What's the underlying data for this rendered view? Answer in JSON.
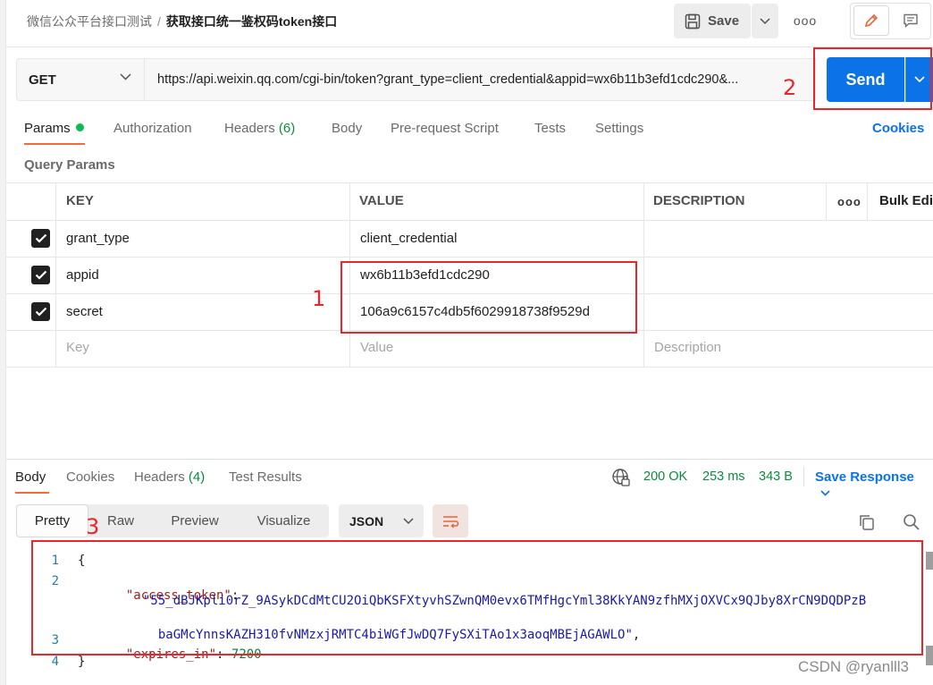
{
  "header": {
    "breadcrumb_parent": "微信公众平台接口测试",
    "breadcrumb_sep": "/",
    "breadcrumb_current": "获取接口统一鉴权码token接口",
    "save_label": "Save",
    "more_label": "ooo"
  },
  "request": {
    "method": "GET",
    "url": "https://api.weixin.qq.com/cgi-bin/token?grant_type=client_credential&appid=wx6b11b3efd1cdc290&...",
    "send_label": "Send"
  },
  "tabs": {
    "params": "Params",
    "authorization": "Authorization",
    "headers": "Headers",
    "headers_count": "(6)",
    "body": "Body",
    "prerequest": "Pre-request Script",
    "tests": "Tests",
    "settings": "Settings",
    "cookies": "Cookies"
  },
  "query_params": {
    "label": "Query Params",
    "columns": {
      "key": "KEY",
      "value": "VALUE",
      "description": "DESCRIPTION",
      "bulk_edit": "Bulk Edit",
      "more": "ooo"
    },
    "rows": [
      {
        "key": "grant_type",
        "value": "client_credential"
      },
      {
        "key": "appid",
        "value": "wx6b11b3efd1cdc290"
      },
      {
        "key": "secret",
        "value": "106a9c6157c4db5f6029918738f9529d"
      }
    ],
    "placeholders": {
      "key": "Key",
      "value": "Value",
      "description": "Description"
    }
  },
  "annotations": {
    "box1": "1",
    "box2": "2",
    "box3": "3",
    "color": "#e8262b"
  },
  "response": {
    "tabs": {
      "body": "Body",
      "cookies": "Cookies",
      "headers": "Headers",
      "headers_count": "(4)",
      "test_results": "Test Results"
    },
    "status": "200 OK",
    "time": "253 ms",
    "size": "343 B",
    "save_response": "Save Response",
    "format_tabs": {
      "pretty": "Pretty",
      "raw": "Raw",
      "preview": "Preview",
      "visualize": "Visualize"
    },
    "format": "JSON",
    "line_numbers": [
      "1",
      "2",
      "3",
      "4"
    ],
    "code": {
      "open": "{",
      "key_access_token": "\"access_token\"",
      "colon": ":",
      "token_line1": "\"55_dBJKpli0rZ_9ASykDCdMtCU2OiQbKSFXtyvhSZwnQM0evx6TMfHgcYml38KkYAN9zfhMXjOXVCx9QJby8XrCN9DQDPzB",
      "token_line2": "baGMcYnnsKAZH310fvNMzxjRMTC4biWGfJwDQ7FySXiTAo1x3aoqMBEjAGAWLO\"",
      "comma": ",",
      "key_expires_in": "\"expires_in\"",
      "expires_value": "7200",
      "close": "}"
    }
  },
  "watermark": "CSDN @ryanlll3",
  "colors": {
    "send_blue": "#0b72e7",
    "status_green": "#0b8b3f",
    "tab_orange": "#f26b3a"
  }
}
